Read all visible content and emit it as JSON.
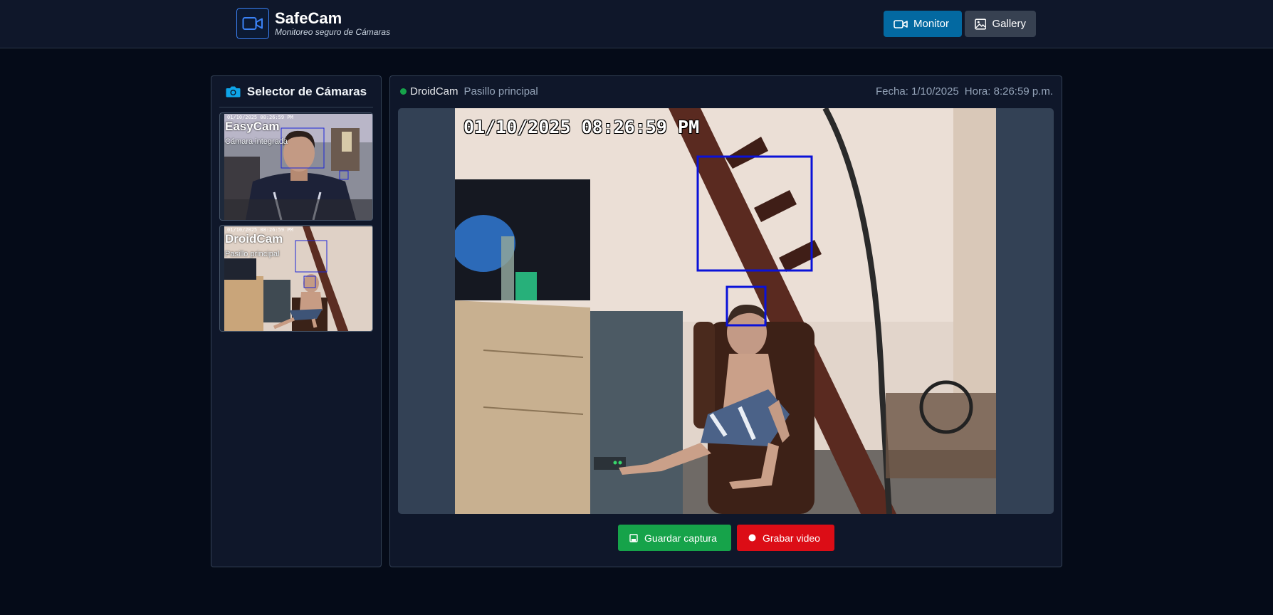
{
  "header": {
    "title": "SafeCam",
    "subtitle": "Monitoreo seguro de Cámaras",
    "nav": [
      {
        "label": "Monitor",
        "icon": "video-icon",
        "active": true
      },
      {
        "label": "Gallery",
        "icon": "image-icon",
        "active": false
      }
    ]
  },
  "sidebar": {
    "title": "Selector de Cámaras",
    "icon": "camera-icon",
    "cameras": [
      {
        "name": "EasyCam",
        "location": "Cámara integrada",
        "timestamp": "01/10/2025 08:26:59 PM"
      },
      {
        "name": "DroidCam",
        "location": "Pasillo principal",
        "timestamp": "01/10/2025 08:26:59 PM"
      }
    ]
  },
  "viewer": {
    "status_color": "#16a34a",
    "camera_name": "DroidCam",
    "camera_location": "Pasillo principal",
    "date_label": "Fecha: 1/10/2025",
    "time_label": "Hora: 8:26:59 p.m.",
    "overlay_timestamp": "01/10/2025 08:26:59 PM"
  },
  "actions": {
    "save_label": "Guardar captura",
    "record_label": "Grabar video"
  },
  "colors": {
    "accent": "#0369a1",
    "save": "#16a34a",
    "record": "#dc0d16",
    "detection_box": "#0a12d8"
  }
}
